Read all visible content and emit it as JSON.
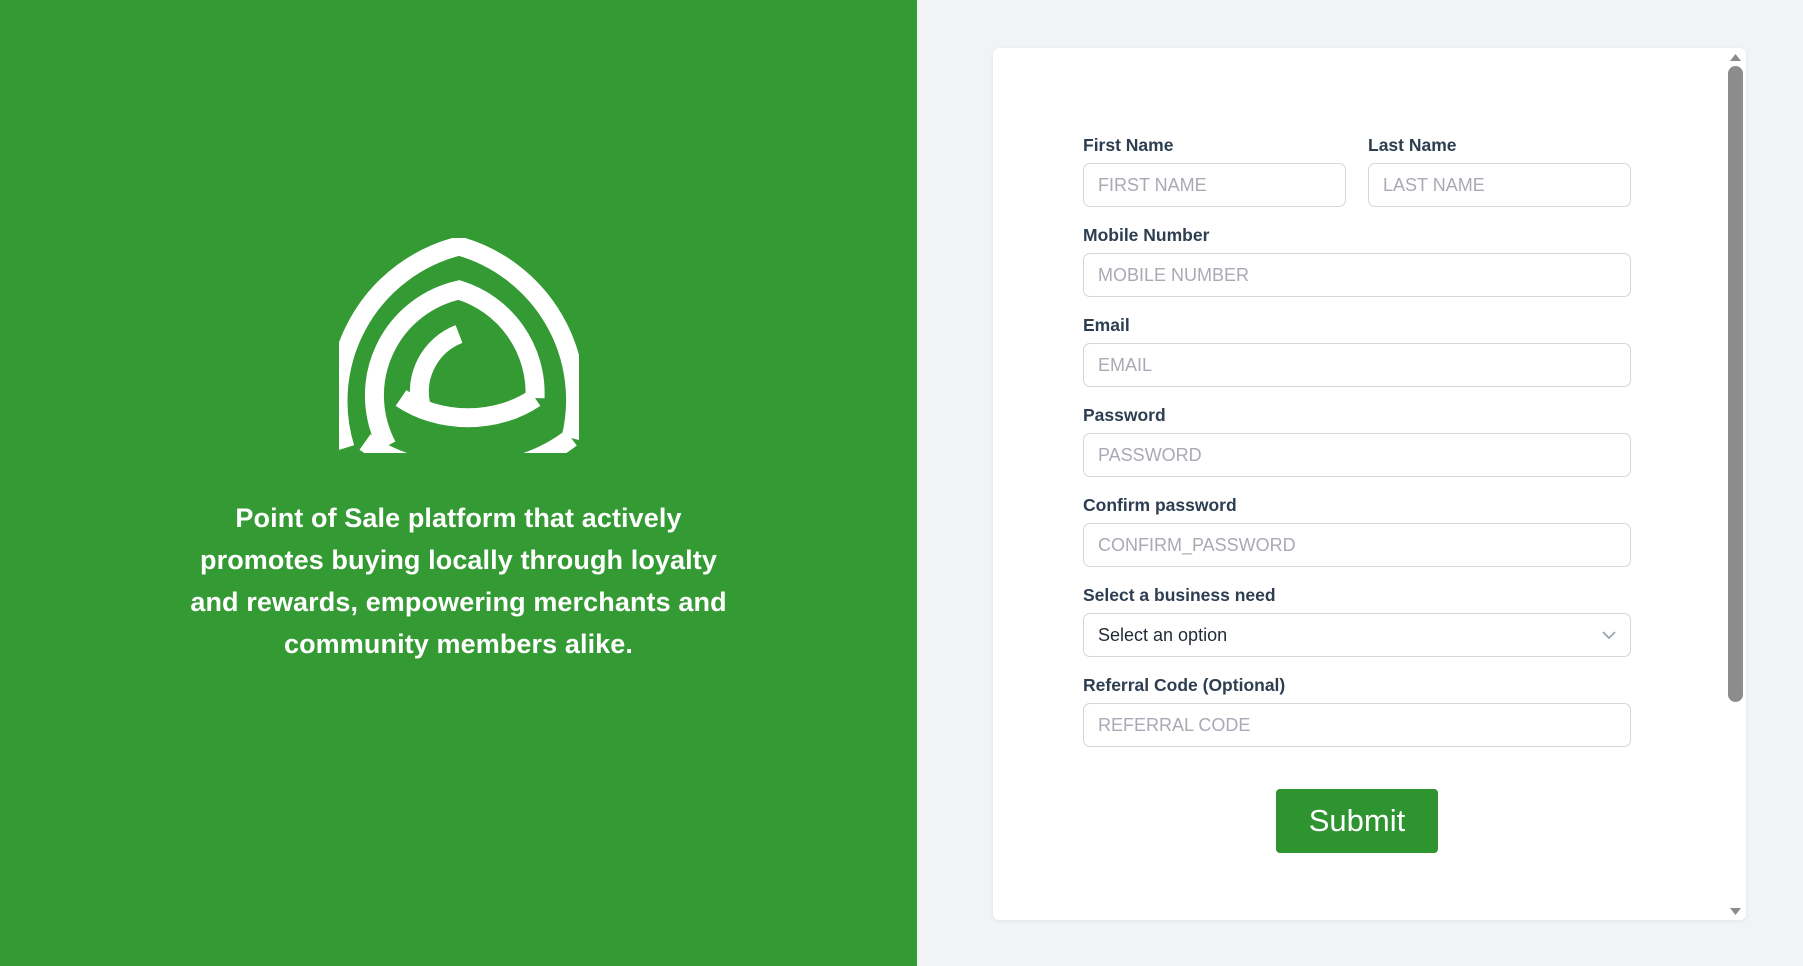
{
  "brand": {
    "logo_icon": "e-trilogy-arcs-logo",
    "tagline": "Point of Sale platform that actively promotes buying locally through loyalty and rewards, empowering merchants and community members alike.",
    "background_color": "#349a33",
    "text_color": "#ffffff"
  },
  "page": {
    "background_color": "#f2f3f5",
    "card_background": "#ffffff"
  },
  "form": {
    "fields": [
      {
        "label": "First Name",
        "placeholder": "FIRST NAME",
        "value": "",
        "type": "text",
        "name": "first-name"
      },
      {
        "label": "Last Name",
        "placeholder": "LAST NAME",
        "value": "",
        "type": "text",
        "name": "last-name"
      },
      {
        "label": "Mobile Number",
        "placeholder": "MOBILE NUMBER",
        "value": "",
        "type": "tel",
        "name": "mobile-number"
      },
      {
        "label": "Email",
        "placeholder": "EMAIL",
        "value": "",
        "type": "email",
        "name": "email"
      },
      {
        "label": "Password",
        "placeholder": "PASSWORD",
        "value": "",
        "type": "text",
        "name": "password"
      },
      {
        "label": "Confirm password",
        "placeholder": "CONFIRM_PASSWORD",
        "value": "",
        "type": "text",
        "name": "confirm-password"
      },
      {
        "label": "Select a business need",
        "placeholder": "",
        "value": "Select an option",
        "type": "select",
        "name": "business-need"
      },
      {
        "label": "Referral Code (Optional)",
        "placeholder": "REFERRAL CODE",
        "value": "",
        "type": "text",
        "name": "referral-code"
      }
    ],
    "select_icon": "chevron-down-icon",
    "submit_label": "Submit",
    "submit_color": "#2e9430"
  },
  "scrollbar": {
    "up_icon": "triangle-up-icon",
    "down_icon": "triangle-down-icon",
    "thumb_color": "#8c8c8c"
  }
}
